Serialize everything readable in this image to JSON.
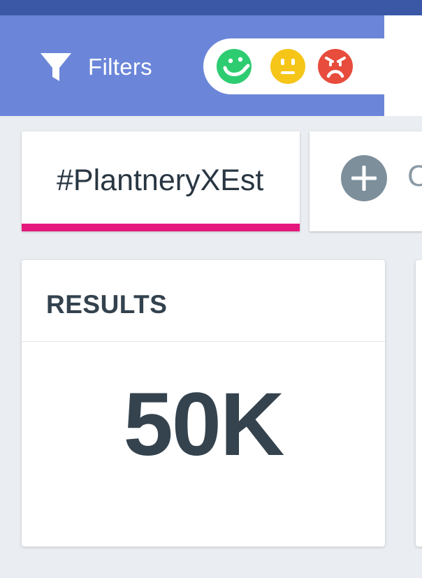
{
  "header": {
    "filter_label": "Filters",
    "filter_icon": "filter-funnel-icon",
    "sentiments": [
      {
        "icon": "happy-face-icon",
        "color": "#2ecc71"
      },
      {
        "icon": "neutral-face-icon",
        "color": "#f5c518"
      },
      {
        "icon": "sad-face-icon",
        "color": "#e74c3c"
      }
    ]
  },
  "tabs": {
    "active_label": "#PlantneryXEst",
    "active_underline_color": "#e5177c",
    "add_icon": "plus-circle-icon",
    "add_label": "C"
  },
  "results_card": {
    "title": "RESULTS",
    "value": "50K"
  },
  "colors": {
    "topbar": "#3a58a6",
    "filterbar": "#6b86d9",
    "background": "#eaedf1"
  }
}
